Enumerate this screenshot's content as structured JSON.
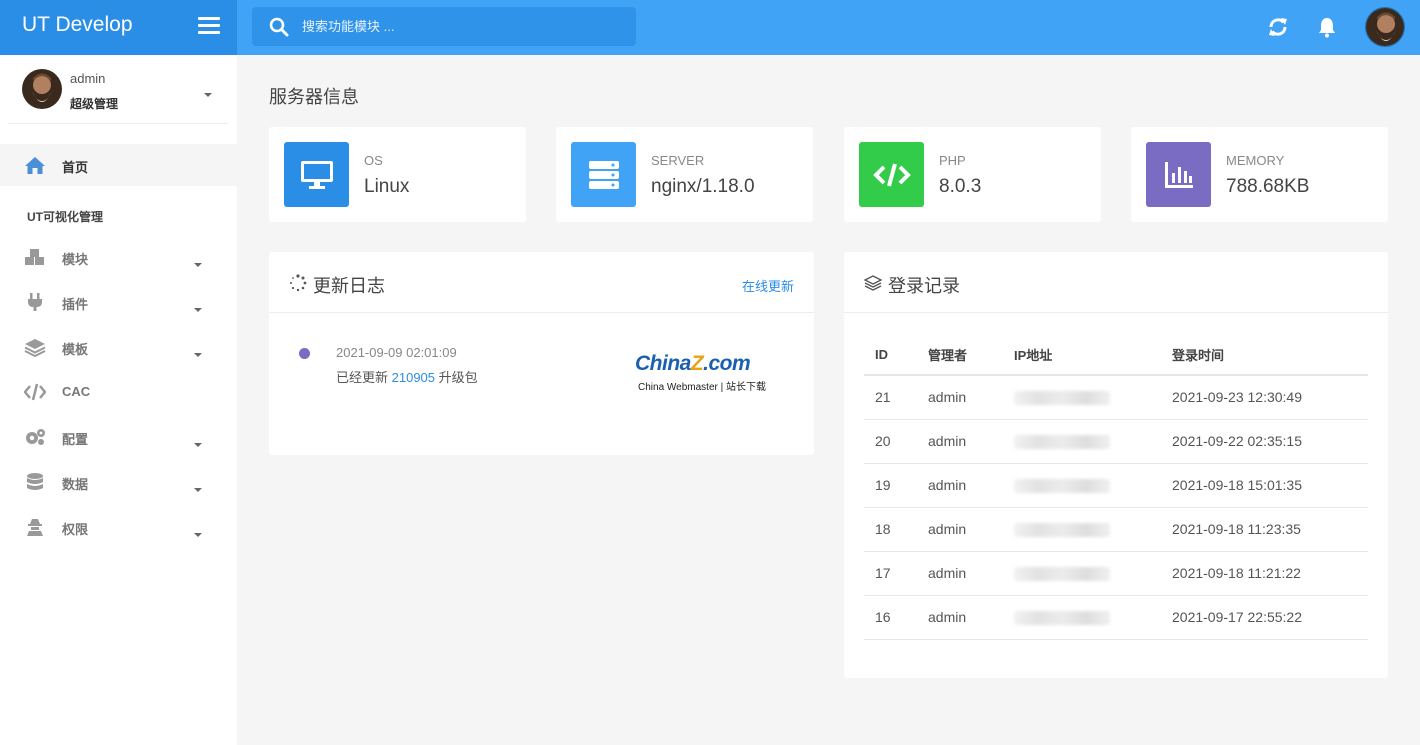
{
  "app": {
    "title": "UT Develop"
  },
  "search": {
    "placeholder": "搜索功能模块 ..."
  },
  "user": {
    "name": "admin",
    "role": "超级管理"
  },
  "sidebar": {
    "home": "首页",
    "section": "UT可视化管理",
    "items": [
      {
        "label": "模块",
        "icon": "cubes-icon",
        "has_submenu": true
      },
      {
        "label": "插件",
        "icon": "plug-icon",
        "has_submenu": true
      },
      {
        "label": "模板",
        "icon": "layers-icon",
        "has_submenu": true
      },
      {
        "label": "CAC",
        "icon": "code-icon",
        "has_submenu": false
      },
      {
        "label": "配置",
        "icon": "gears-icon",
        "has_submenu": true
      },
      {
        "label": "数据",
        "icon": "database-icon",
        "has_submenu": true
      },
      {
        "label": "权限",
        "icon": "user-secret-icon",
        "has_submenu": true
      }
    ]
  },
  "main": {
    "title": "服务器信息",
    "stats": [
      {
        "label": "OS",
        "value": "Linux",
        "color": "#2a8ee6",
        "icon": "desktop-icon"
      },
      {
        "label": "SERVER",
        "value": "nginx/1.18.0",
        "color": "#41a3f5",
        "icon": "server-icon"
      },
      {
        "label": "PHP",
        "value": "8.0.3",
        "color": "#33cc4a",
        "icon": "code-icon"
      },
      {
        "label": "MEMORY",
        "value": "788.68KB",
        "color": "#7a6cc2",
        "icon": "bar-chart-icon"
      }
    ],
    "changelog": {
      "title": "更新日志",
      "link": "在线更新",
      "entry": {
        "time": "2021-09-09 02:01:09",
        "prefix": "已经更新",
        "version": "210905",
        "suffix": "升级包"
      },
      "logo": {
        "main_a": "China",
        "main_z": "Z",
        "main_b": ".com",
        "sub": "China Webmaster | 站长下载"
      }
    },
    "login_log": {
      "title": "登录记录",
      "columns": [
        "ID",
        "管理者",
        "IP地址",
        "登录时间"
      ],
      "rows": [
        {
          "id": "21",
          "user": "admin",
          "time": "2021-09-23 12:30:49"
        },
        {
          "id": "20",
          "user": "admin",
          "time": "2021-09-22 02:35:15"
        },
        {
          "id": "19",
          "user": "admin",
          "time": "2021-09-18 15:01:35"
        },
        {
          "id": "18",
          "user": "admin",
          "time": "2021-09-18 11:23:35"
        },
        {
          "id": "17",
          "user": "admin",
          "time": "2021-09-18 11:21:22"
        },
        {
          "id": "16",
          "user": "admin",
          "time": "2021-09-17 22:55:22"
        }
      ]
    }
  }
}
